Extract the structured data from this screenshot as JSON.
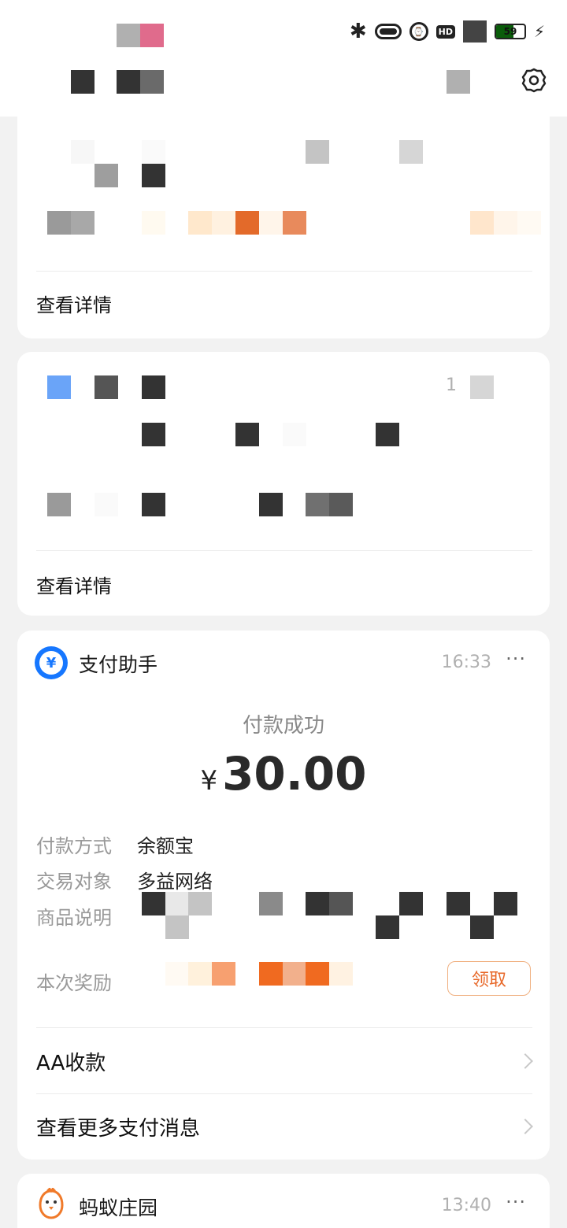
{
  "status_bar": {
    "battery_level": "59",
    "icons": [
      "bluetooth-icon",
      "pill-icon",
      "alarm-icon",
      "hd-icon",
      "signal-icon",
      "battery-icon",
      "charging-icon"
    ]
  },
  "header": {
    "settings_icon": "gear-icon"
  },
  "card1": {
    "detail_link": "查看详情"
  },
  "card2": {
    "count": "1",
    "detail_link": "查看详情"
  },
  "payment_card": {
    "icon": "yuan-icon",
    "icon_glyph": "¥",
    "title": "支付助手",
    "time": "16:33",
    "more": "···",
    "status": "付款成功",
    "currency": "¥",
    "amount": "30.00",
    "rows": [
      {
        "label": "付款方式",
        "value": "余额宝"
      },
      {
        "label": "交易对象",
        "value": "多益网络"
      },
      {
        "label": "商品说明",
        "value": ""
      }
    ],
    "reward_label": "本次奖励",
    "claim_button": "领取",
    "aa_label": "AA收款",
    "more_payments_label": "查看更多支付消息"
  },
  "farm_card": {
    "icon": "chick-icon",
    "title": "蚂蚁庄园",
    "time": "13:40",
    "more": "···"
  },
  "colors": {
    "background": "#f2f2f2",
    "accent_blue": "#1677ff",
    "accent_orange": "#e8692a"
  }
}
